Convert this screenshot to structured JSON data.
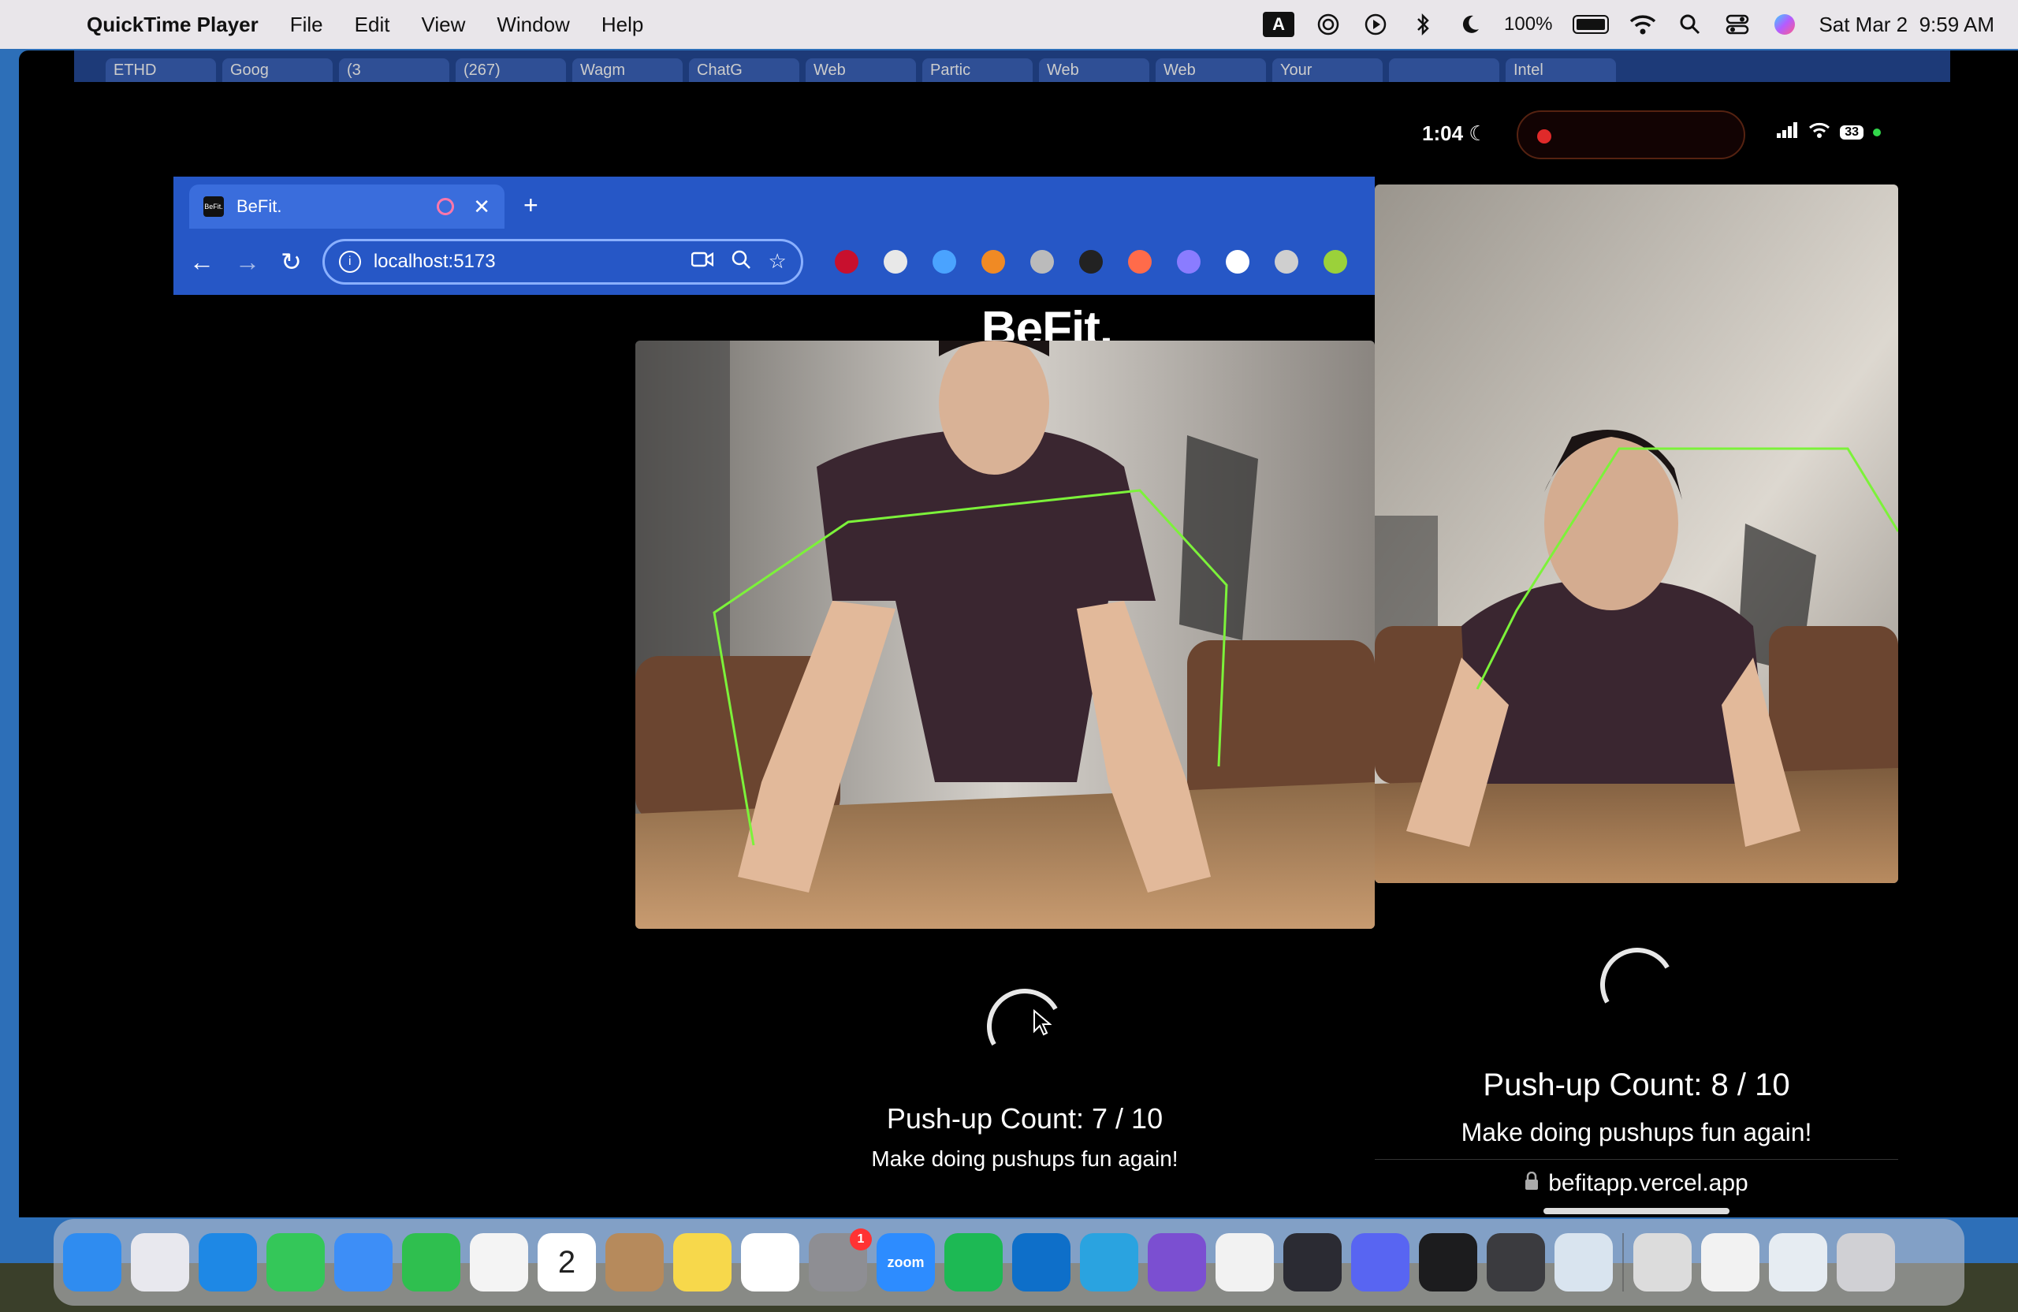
{
  "menubar": {
    "app_name": "QuickTime Player",
    "menus": [
      "File",
      "Edit",
      "View",
      "Window",
      "Help"
    ],
    "input_source": "A",
    "battery_percent": "100%",
    "datetime": "Sat Mar 2  9:59 AM"
  },
  "qt_tabs": [
    "ETHD",
    "Goog",
    "(3",
    "(267)",
    "Wagm",
    "ChatG",
    "Web",
    "Partic",
    "Web",
    "Web",
    "Your",
    "",
    "Intel"
  ],
  "browser": {
    "tab_title": "BeFit.",
    "favicon_text": "BeFit.",
    "new_tab": "+",
    "url": "localhost:5173",
    "extension_colors": [
      "#c8102e",
      "#e8e8e8",
      "#4aa3ff",
      "#f08a24",
      "#bbbbbb",
      "#222222",
      "#ff6b4a",
      "#8a7cff",
      "#ffffff",
      "#cfcfcf",
      "#9bd13a"
    ]
  },
  "desktop_app": {
    "logo": "BeFit.",
    "pushup_count": "Push-up Count: 7 / 10",
    "tagline": "Make doing pushups fun again!"
  },
  "phone": {
    "time": "1:04",
    "battery": "33",
    "pushup_count": "Push-up Count: 8 / 10",
    "tagline": "Make doing pushups fun again!",
    "url": "befitapp.vercel.app"
  },
  "dock": {
    "apps": [
      {
        "name": "Finder",
        "color": "#2f8cf0",
        "label": ""
      },
      {
        "name": "Launchpad",
        "color": "#e8e8ee",
        "label": ""
      },
      {
        "name": "Safari",
        "color": "#1e88e5",
        "label": ""
      },
      {
        "name": "Messages",
        "color": "#34c759",
        "label": ""
      },
      {
        "name": "Mail",
        "color": "#3d8ef7",
        "label": ""
      },
      {
        "name": "FaceTime",
        "color": "#2fbf4f",
        "label": ""
      },
      {
        "name": "Photos",
        "color": "#f4f4f4",
        "label": ""
      },
      {
        "name": "Calendar",
        "color": "#ffffff",
        "label": "2"
      },
      {
        "name": "Contacts",
        "color": "#b68a5c",
        "label": ""
      },
      {
        "name": "Notes",
        "color": "#f7d84b",
        "label": ""
      },
      {
        "name": "Freeform",
        "color": "#ffffff",
        "label": ""
      },
      {
        "name": "System Settings",
        "color": "#8e8e93",
        "label": "",
        "badge": "1"
      },
      {
        "name": "Zoom",
        "color": "#2d8cff",
        "label": "zoom"
      },
      {
        "name": "Spotify",
        "color": "#1db954",
        "label": ""
      },
      {
        "name": "VS Code",
        "color": "#0e6fc9",
        "label": ""
      },
      {
        "name": "Telegram",
        "color": "#2aa3e0",
        "label": ""
      },
      {
        "name": "GitHub Desktop",
        "color": "#7b4fd1",
        "label": ""
      },
      {
        "name": "Chrome",
        "color": "#f2f2f2",
        "label": ""
      },
      {
        "name": "DaVinci Resolve",
        "color": "#2b2b33",
        "label": ""
      },
      {
        "name": "Discord",
        "color": "#5865f2",
        "label": ""
      },
      {
        "name": "Voice Memos",
        "color": "#1c1c1e",
        "label": ""
      },
      {
        "name": "QuickTime Player",
        "color": "#3b3b3f",
        "label": ""
      },
      {
        "name": "Preview",
        "color": "#d9e4ef",
        "label": ""
      }
    ],
    "recent": [
      {
        "name": "Document Stack",
        "color": "#dcdcdc"
      },
      {
        "name": "File",
        "color": "#f2f2f2"
      },
      {
        "name": "Screenshot",
        "color": "#e6ecf2"
      },
      {
        "name": "Trash",
        "color": "#d0d0d4"
      }
    ]
  }
}
